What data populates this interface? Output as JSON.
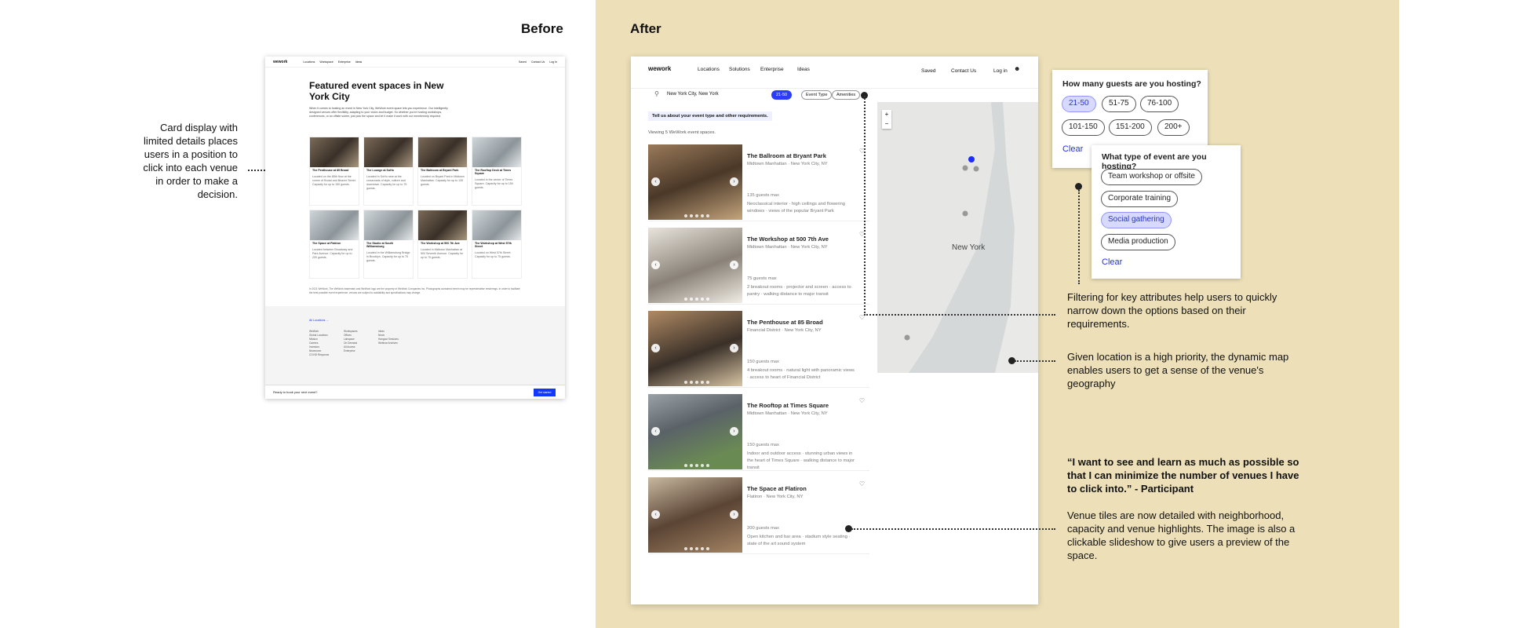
{
  "headings": {
    "before": "Before",
    "after": "After"
  },
  "before_annotation": "Card display with limited details places users in a position to click into each venue in order to make a decision.",
  "before_page": {
    "logo": "wework",
    "nav": [
      "Locations",
      "Workspace",
      "Enterprise",
      "Ideas"
    ],
    "nav_right": [
      "Saved",
      "Contact Us",
      "Log In"
    ],
    "title": "Featured event spaces in New York City",
    "intro": "When it comes to hosting an event in New York City, WeWork event space lets you experience. Our intelligently designed venues offer flexibility, adapting to your vision and budget. So whether you're hosting workshops, conferences, or an offsite soiree, just pick the space and let it make it work with our membership required.",
    "cards": [
      {
        "title": "The Penthouse at 85 Broad",
        "desc": "Located on the 85th floor at the corner of Broad and Beaver Street. Capacity for up to 150 guests."
      },
      {
        "title": "The Lounge at SoHo",
        "desc": "Located in SoHo near at the crossroads of style, culture and downtown. Capacity for up to 75 guests."
      },
      {
        "title": "The Ballroom at Bryant Park",
        "desc": "Located on Bryant Park in Midtown Manhattan. Capacity for up to 135 guests."
      },
      {
        "title": "The Rooftop Deck at Times Square",
        "desc": "Located in the center of Times Square. Capacity for up to 150 guests."
      },
      {
        "title": "The Space at Flatiron",
        "desc": "Located between Broadway and Park Avenue. Capacity for up to 200 guests."
      },
      {
        "title": "The Studio at South Williamsburg",
        "desc": "Located in the Williamsburg Bridge in Brooklyn. Capacity for up to 75 guests."
      },
      {
        "title": "The Workshop at 500 7th Ave",
        "desc": "Located in Midtown Manhattan at 500 Seventh Avenue. Capacity for up to 75 guests."
      },
      {
        "title": "The Workshop at West 57th Street",
        "desc": "Located on West 57th Street. Capacity for up to 75 guests."
      }
    ],
    "body_text": "In 2021 WeWork, The WeWork trademark and WeWork logo are the property of WeWork Companies Inc. Photographs contained herein may be representative renderings. In order to facilitate the best possible event experience, venues are subject to availability and specifications may change.",
    "footer_link": "All Locations →",
    "footer_cols": [
      "WeWork\nGlobal Locations\nMission\nCareers\nInvestors\nNewsroom\nCOVID Response",
      "Workspaces\nOffices\nLabspace\nOn Demand\nAll Access\nEnterprise",
      "Ideas\nNews\nHangout Sessions\nWebinar Archives"
    ],
    "bottom_text": "Ready to book your next event?",
    "bottom_button": "Get started"
  },
  "after_page": {
    "logo": "wework",
    "nav": [
      "Locations",
      "Solutions",
      "Enterprise",
      "Ideas"
    ],
    "nav_right": [
      "Saved",
      "Contact Us",
      "Log in"
    ],
    "search_value": "New York City, New York",
    "filter_pills": [
      "21-50",
      "Event Type",
      "Amenities"
    ],
    "tip": "Tell us about your event type and other requirements.",
    "count_text": "Viewing 5 WeWork event spaces.",
    "venues": [
      {
        "name": "The Ballroom at Bryant Park",
        "loc": "Midtown Manhattan · New York City, NY",
        "cap": "135 guests max",
        "hl": "Neoclassical interior · high ceilings and flowering windows · views of the popular Bryant Park"
      },
      {
        "name": "The Workshop at 500 7th Ave",
        "loc": "Midtown Manhattan · New York City, NY",
        "cap": "75 guests max",
        "hl": "2 breakout rooms · projector and screen · access to pantry · walking distance to major transit"
      },
      {
        "name": "The Penthouse at 85 Broad",
        "loc": "Financial District · New York City, NY",
        "cap": "150 guests max",
        "hl": "4 breakout rooms · natural light with panoramic views · access to heart of Financial District"
      },
      {
        "name": "The Rooftop at Times Square",
        "loc": "Midtown Manhattan · New York City, NY",
        "cap": "150 guests max",
        "hl": "Indoor and outdoor access · stunning urban views in the heart of Times Square · walking distance to major transit"
      },
      {
        "name": "The Space at Flatiron",
        "loc": "Flatiron · New York City, NY",
        "cap": "200 guests max",
        "hl": "Open kitchen and bar area · stadium style seating · state of the art sound system"
      }
    ],
    "map_label": "New York",
    "map_zoom": [
      "+",
      "−"
    ]
  },
  "guests_popup": {
    "title": "How many guests are you hosting?",
    "options": [
      "21-50",
      "51-75",
      "76-100",
      "101-150",
      "151-200",
      "200+"
    ],
    "clear": "Clear"
  },
  "event_popup": {
    "title": "What type of event are you hosting?",
    "options": [
      "Team workshop or offsite",
      "Corporate training",
      "Social gathering",
      "Media production"
    ],
    "clear": "Clear"
  },
  "annotations": {
    "filter": "Filtering for key attributes help users to quickly narrow down the options based on their requirements.",
    "map": "Given location is a high priority, the dynamic map enables users to get a sense of the venue's geography",
    "quote": "“I want to see and learn as much as possible so that I can minimize the number of venues I have to click into.”",
    "quote_attr": " - Participant",
    "tiles": "Venue tiles are now detailed with neighborhood, capacity and venue highlights. The image is also a clickable slideshow to give users a preview of the space."
  },
  "colors": {
    "accent": "#1d2cff",
    "after_bg": "#ede0b8",
    "chip_selected": "#d7d9ff"
  }
}
